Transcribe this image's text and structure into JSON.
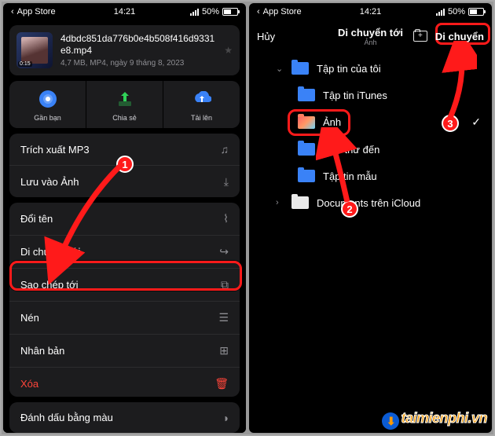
{
  "status": {
    "appstore": "App Store",
    "signal_icon": "signal-icon",
    "time": "14:21",
    "battery_pct": "50%"
  },
  "left": {
    "file": {
      "thumb_time": "0:15",
      "name": "4dbdc851da776b0e4b508f416d9331e8.mp4",
      "meta": "4,7 MB, MP4, ngày 9 tháng 8, 2023"
    },
    "share": [
      {
        "icon": "nearby-icon",
        "label": "Gần bạn"
      },
      {
        "icon": "share-icon",
        "label": "Chia sẻ"
      },
      {
        "icon": "upload-icon",
        "label": "Tải lên"
      }
    ],
    "group1": [
      {
        "label": "Trích xuất MP3",
        "icon": "music-note-icon"
      },
      {
        "label": "Lưu vào Ảnh",
        "icon": "save-image-icon"
      }
    ],
    "group2": [
      {
        "label": "Đổi tên",
        "icon": "rename-icon"
      },
      {
        "label": "Di chuyển tới",
        "icon": "move-to-icon"
      },
      {
        "label": "Sao chép tới",
        "icon": "copy-to-icon"
      },
      {
        "label": "Nén",
        "icon": "compress-icon"
      },
      {
        "label": "Nhân bản",
        "icon": "duplicate-icon"
      },
      {
        "label": "Xóa",
        "icon": "trash-icon",
        "danger": true
      }
    ],
    "group3": [
      {
        "label": "Đánh dấu bằng màu",
        "icon": "color-tag-icon"
      }
    ]
  },
  "right": {
    "cancel": "Hủy",
    "title": "Di chuyển tới",
    "subtitle": "Ảnh",
    "new_folder_icon": "new-folder-icon",
    "move": "Di chuyển",
    "tree": [
      {
        "level": 1,
        "chev": "▾",
        "folder": "f-blue",
        "label": "Tập tin của tôi"
      },
      {
        "level": 2,
        "folder": "f-blue",
        "label": "Tập tin iTunes"
      },
      {
        "level": 2,
        "folder": "f-grad",
        "label": "Ảnh",
        "checked": true,
        "highlight": true
      },
      {
        "level": 2,
        "folder": "f-blue",
        "label": "Hộp thư đến"
      },
      {
        "level": 2,
        "folder": "f-blue",
        "label": "Tập tin mẫu"
      },
      {
        "level": 1,
        "folder": "f-drive",
        "label": "Documents trên iCloud",
        "drive": true
      }
    ]
  },
  "callouts": {
    "n1": "1",
    "n2": "2",
    "n3": "3"
  },
  "watermark": {
    "brand1": "taimienphi",
    "brand2": ".vn"
  }
}
